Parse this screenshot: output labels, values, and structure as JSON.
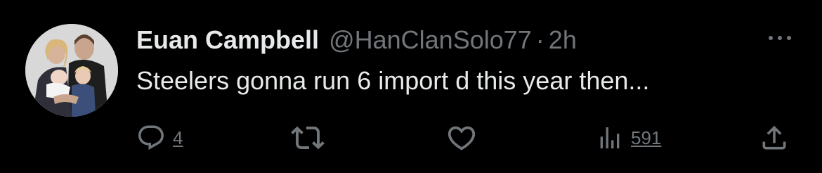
{
  "tweet": {
    "author_name": "Euan Campbell",
    "handle": "@HanClanSolo77",
    "separator": "·",
    "time": "2h",
    "text": "Steelers gonna run 6 import d this year then...",
    "more_icon": "more-horizontal-icon"
  },
  "actions": {
    "reply": {
      "icon": "reply-icon",
      "count": "4"
    },
    "retweet": {
      "icon": "retweet-icon",
      "count": ""
    },
    "like": {
      "icon": "heart-icon",
      "count": ""
    },
    "views": {
      "icon": "views-chart-icon",
      "count": "591"
    },
    "share": {
      "icon": "share-icon"
    }
  },
  "colors": {
    "background": "#000000",
    "primary_text": "#e7e9ea",
    "secondary_text": "#71767b"
  }
}
